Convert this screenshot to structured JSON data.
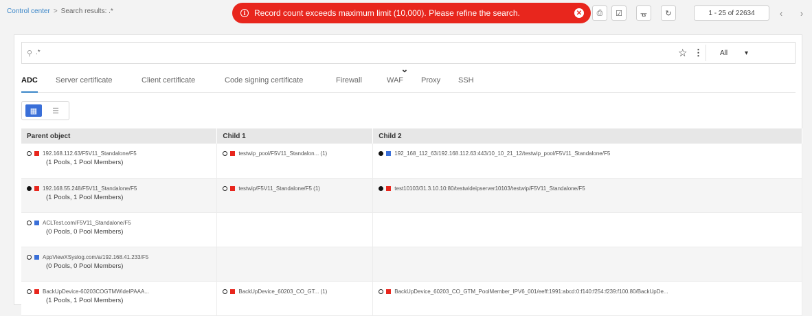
{
  "breadcrumb": {
    "home": "Control center",
    "separator": ">",
    "current": "Search results: .*"
  },
  "alert": {
    "message": "Record count exceeds maximum limit (10,000). Please refine the search."
  },
  "pager": {
    "text": "1 - 25 of 22634"
  },
  "search": {
    "value": ".*",
    "filter": "All"
  },
  "tabs": [
    {
      "label": "ADC"
    },
    {
      "label": "Server certificate"
    },
    {
      "label": "Client certificate"
    },
    {
      "label": "Code signing certificate"
    },
    {
      "label": "Firewall"
    },
    {
      "label": "WAF"
    },
    {
      "label": "Proxy"
    },
    {
      "label": "SSH"
    }
  ],
  "table": {
    "headers": [
      "Parent object",
      "Child 1",
      "Child 2"
    ],
    "rows": [
      {
        "parent": {
          "status": "open",
          "color": "red",
          "name": "192.168.112.63/F5V11_Standalone/F5",
          "sub": "(1 Pools, 1 Pool Members)"
        },
        "child1": {
          "status": "open",
          "color": "red",
          "name": "testwip_pool/F5V11_Standalon... (1)"
        },
        "child2": {
          "status": "filled",
          "color": "blue",
          "name": "192_168_112_63/192.168.112.63:443/10_10_21_12/testwip_pool/F5V11_Standalone/F5"
        }
      },
      {
        "parent": {
          "status": "filled",
          "color": "red",
          "name": "192.168.55.248/F5V11_Standalone/F5",
          "sub": "(1 Pools, 1 Pool Members)"
        },
        "child1": {
          "status": "open",
          "color": "red",
          "name": "testwip/F5V11_Standalone/F5 (1)"
        },
        "child2": {
          "status": "filled",
          "color": "red",
          "name": "test10103/31.3.10.10:80/testwideipserver10103/testwip/F5V11_Standalone/F5"
        }
      },
      {
        "parent": {
          "status": "open",
          "color": "blue",
          "name": "ACLTest.com/F5V11_Standalone/F5",
          "sub": "(0 Pools, 0 Pool Members)"
        },
        "child1": null,
        "child2": null
      },
      {
        "parent": {
          "status": "open",
          "color": "blue",
          "name": "AppViewXSyslog.com/a/192.168.41.233/F5",
          "sub": "(0 Pools, 0 Pool Members)"
        },
        "child1": null,
        "child2": null
      },
      {
        "parent": {
          "status": "open",
          "color": "red",
          "name": "BackUpDevice-60203COGTMWideIPAAA...",
          "sub": "(1 Pools, 1 Pool Members)"
        },
        "child1": {
          "status": "open",
          "color": "red",
          "name": "BackUpDevice_60203_CO_GT... (1)"
        },
        "child2": {
          "status": "open",
          "color": "red",
          "name": "BackUpDevice_60203_CO_GTM_PoolMember_IPV6_001/eeff:1991:abcd:0:f140:f254:f239:f100.80/BackUpDe..."
        }
      }
    ]
  },
  "icons": {
    "toolbar": [
      "export-icon",
      "checkbox-icon",
      "hierarchy-icon",
      "refresh-icon"
    ],
    "prev": "chevron-left-icon",
    "next": "chevron-right-icon"
  }
}
